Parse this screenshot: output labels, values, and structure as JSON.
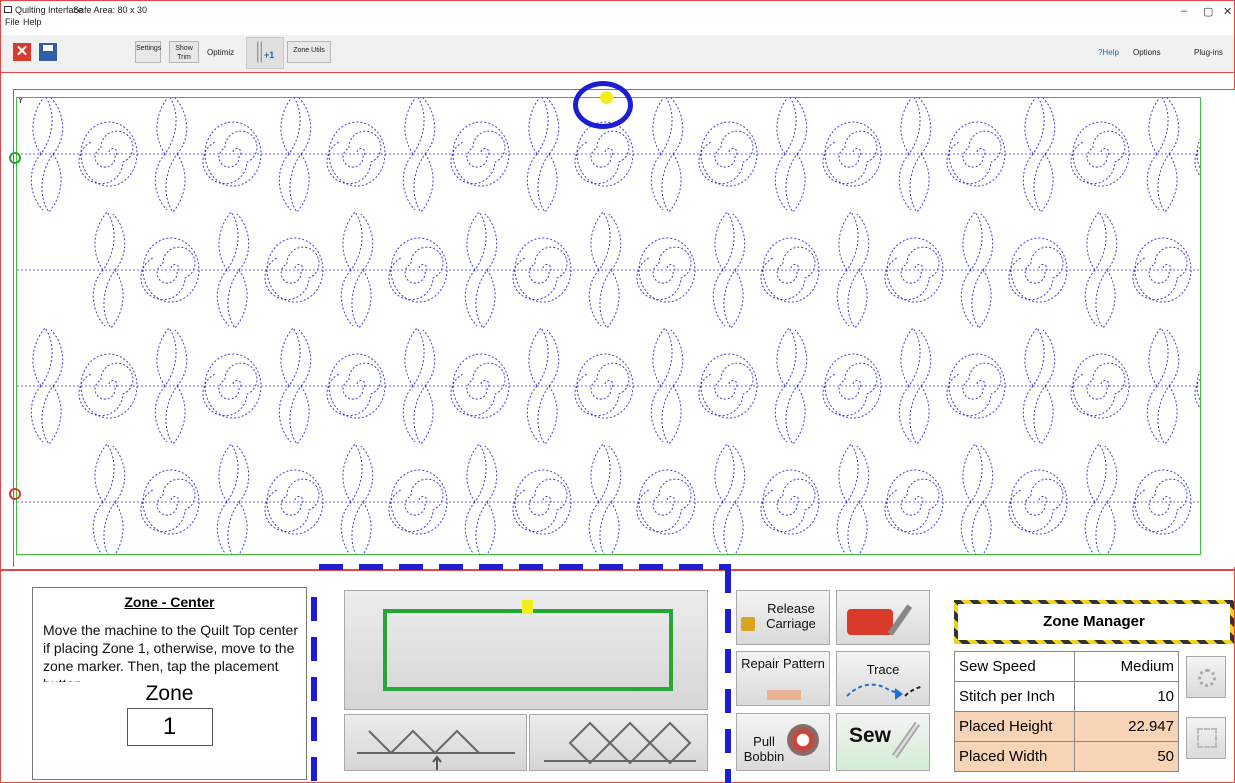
{
  "app": {
    "title": "Quilting Interface",
    "safe_area": "Safe Area: 80 x 30"
  },
  "menu": {
    "file": "File",
    "help": "Help"
  },
  "window": {
    "minimize": "–",
    "restore": "▢",
    "close": "✕"
  },
  "toolbar": {
    "close_icon": "✕",
    "settings_label": "Settings",
    "show_trim_label": "Show Trim",
    "optimize_label": "Optimiz",
    "needle_label": "+1",
    "zone_utils_label": "Zone Utils",
    "help_label": "?Help",
    "options_label": "Options",
    "plugins_label": "Plug-ins"
  },
  "canvas": {
    "corner_label": "Y"
  },
  "zone_panel": {
    "title": "Zone - Center",
    "description": "Move the machine to the Quilt Top center if placing Zone 1, otherwise, move to the zone marker. Then, tap the placement button.",
    "zone_label": "Zone",
    "zone_value": "1"
  },
  "actions": {
    "release_carriage": "Release Carriage",
    "repair_pattern": "Repair Pattern",
    "trace": "Trace",
    "pull_bobbin": "Pull Bobbin",
    "sew": "Sew"
  },
  "zone_manager": {
    "title": "Zone Manager",
    "rows": [
      {
        "label": "Sew Speed",
        "value": "Medium"
      },
      {
        "label": "Stitch per Inch",
        "value": "10"
      },
      {
        "label": "Placed Height",
        "value": "22.947"
      },
      {
        "label": "Placed Width",
        "value": "50"
      }
    ]
  },
  "colors": {
    "accent_red": "#e64646",
    "annot_blue": "#1d1dd6",
    "quilt_green": "#26a636",
    "stitch_blue": "#3b3bd6",
    "marker_yellow": "#f2ee1b"
  }
}
